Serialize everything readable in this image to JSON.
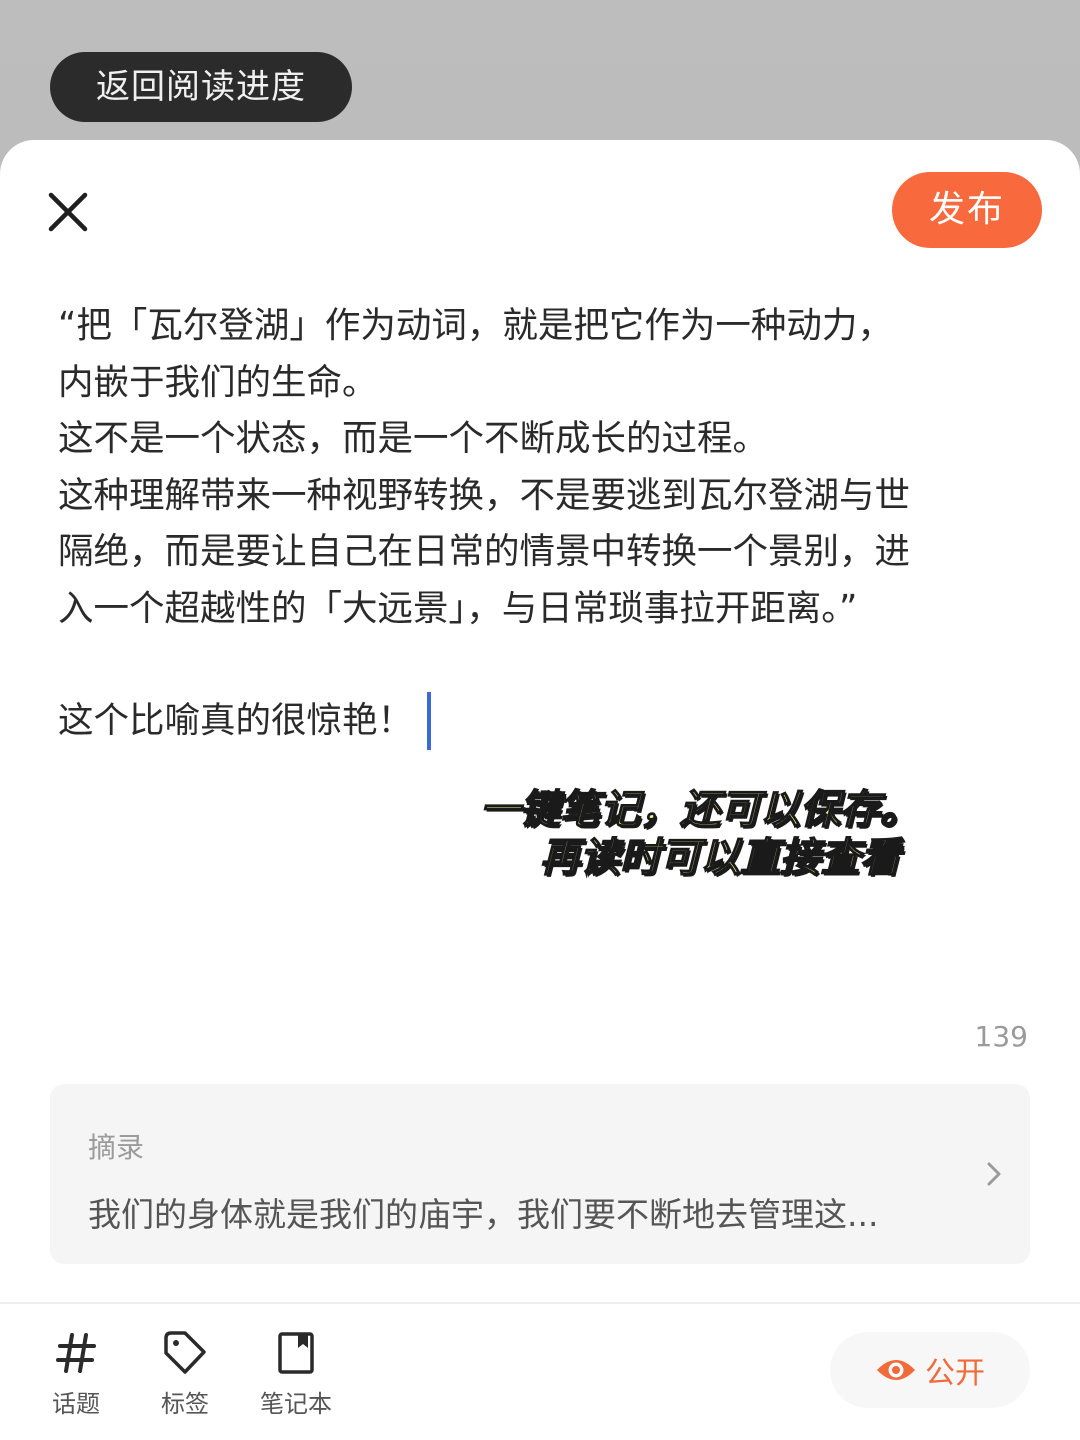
{
  "back_button": {
    "label": "返回阅读进度"
  },
  "toolbar": {
    "publish_label": "发布"
  },
  "note": {
    "quote_lines": [
      "“把「瓦尔登湖」作为动词，就是把它作为一种动力，",
      "内嵌于我们的生命。",
      "这不是一个状态，而是一个不断成长的过程。",
      "这种理解带来一种视野转换，不是要逃到瓦尔登湖与世",
      "隔绝，而是要让自己在日常的情景中转换一个景别，进",
      "入一个超越性的「大远景」，与日常琐事拉开距离。”"
    ],
    "comment": "这个比喻真的很惊艳！"
  },
  "overlay_caption": {
    "line1": "一键笔记，还可以保存。",
    "line2": "再读时可以直接查看"
  },
  "char_count": "139",
  "excerpt": {
    "label": "摘录",
    "text": "我们的身体就是我们的庙宇，我们要不断地去管理这..."
  },
  "bottom_tools": {
    "topic_label": "话题",
    "tag_label": "标签",
    "notebook_label": "笔记本"
  },
  "visibility": {
    "label": "公开"
  },
  "colors": {
    "accent": "#f86a3d",
    "caret": "#3b6ad8",
    "overlay_text": "#f4f08a"
  }
}
